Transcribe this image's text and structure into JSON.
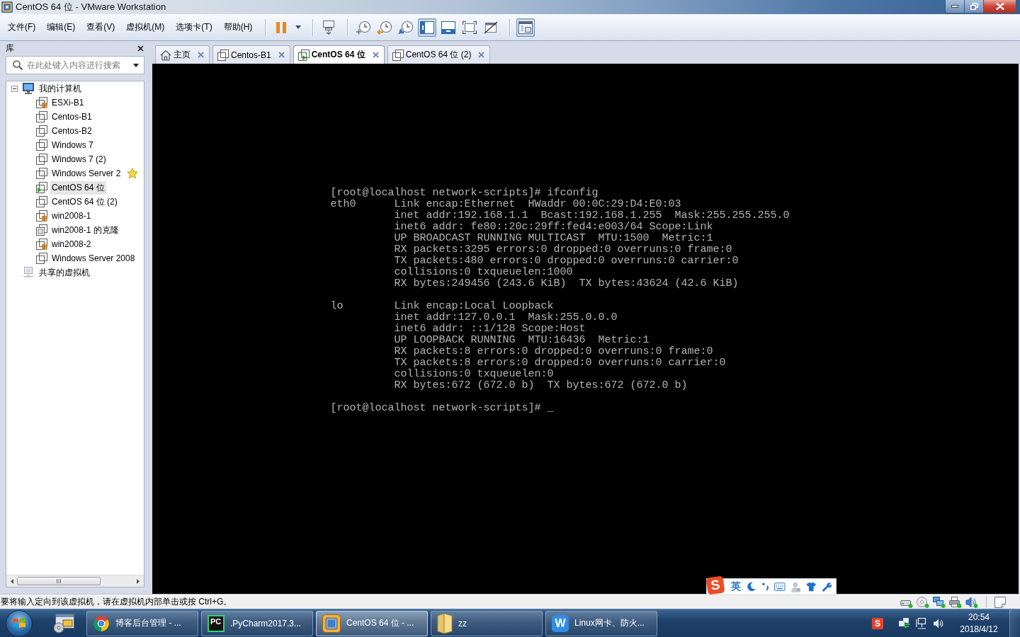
{
  "window": {
    "title": "CentOS 64 位 - VMware Workstation"
  },
  "menu": [
    "文件(F)",
    "编辑(E)",
    "查看(V)",
    "虚拟机(M)",
    "选项卡(T)",
    "帮助(H)"
  ],
  "toolbar": {
    "view_toggles": [
      {
        "selected": true
      },
      {
        "selected": false
      },
      {
        "selected": false
      },
      {
        "selected": false
      },
      {
        "selected": true
      }
    ]
  },
  "library": {
    "title": "库",
    "search": {
      "placeholder": "在此处键入内容进行搜索"
    },
    "tree": [
      {
        "label": "我的计算机",
        "kind": "computer",
        "expanded": true,
        "selected": false,
        "children": [
          {
            "label": "ESXi-B1",
            "kind": "vm",
            "running": false,
            "suspended": true,
            "favorite": false,
            "selected": false
          },
          {
            "label": "Centos-B1",
            "kind": "vm",
            "running": false,
            "suspended": false,
            "favorite": false,
            "selected": false
          },
          {
            "label": "Centos-B2",
            "kind": "vm",
            "running": false,
            "suspended": false,
            "favorite": false,
            "selected": false
          },
          {
            "label": "Windows 7",
            "kind": "vm",
            "running": false,
            "suspended": false,
            "favorite": false,
            "selected": false
          },
          {
            "label": "Windows 7 (2)",
            "kind": "vm",
            "running": false,
            "suspended": false,
            "favorite": false,
            "selected": false
          },
          {
            "label": "Windows Server 2",
            "kind": "vm",
            "running": false,
            "suspended": false,
            "favorite": true,
            "selected": false
          },
          {
            "label": "CentOS 64 位",
            "kind": "vm",
            "running": true,
            "suspended": false,
            "favorite": false,
            "selected": true
          },
          {
            "label": "CentOS 64 位 (2)",
            "kind": "vm",
            "running": false,
            "suspended": false,
            "favorite": false,
            "selected": false
          },
          {
            "label": "win2008-1",
            "kind": "vm",
            "running": false,
            "suspended": true,
            "favorite": false,
            "selected": false
          },
          {
            "label": "win2008-1 的克隆",
            "kind": "clone",
            "running": false,
            "suspended": false,
            "favorite": false,
            "selected": false
          },
          {
            "label": "win2008-2",
            "kind": "vm",
            "running": false,
            "suspended": true,
            "favorite": false,
            "selected": false
          },
          {
            "label": "Windows Server 2008",
            "kind": "vm",
            "running": false,
            "suspended": false,
            "favorite": false,
            "selected": false
          }
        ]
      },
      {
        "label": "共享的虚拟机",
        "kind": "shared",
        "selected": false
      }
    ]
  },
  "tabs": [
    {
      "label": "主页",
      "kind": "home",
      "selected": false
    },
    {
      "label": "Centos-B1",
      "kind": "vm",
      "running": false,
      "selected": false
    },
    {
      "label": "CentOS 64 位",
      "kind": "vm",
      "running": true,
      "selected": true
    },
    {
      "label": "CentOS 64 位 (2)",
      "kind": "vm",
      "running": false,
      "selected": false
    }
  ],
  "console": {
    "entries": [
      {
        "kind": "prompt",
        "text": "[root@localhost network-scripts]# ifconfig"
      },
      {
        "kind": "interface",
        "name": "eth0",
        "lines": [
          "Link encap:Ethernet  HWaddr 00:0C:29:D4:E0:03",
          "inet addr:192.168.1.1  Bcast:192.168.1.255  Mask:255.255.255.0",
          "inet6 addr: fe80::20c:29ff:fed4:e003/64 Scope:Link",
          "UP BROADCAST RUNNING MULTICAST  MTU:1500  Metric:1",
          "RX packets:3295 errors:0 dropped:0 overruns:0 frame:0",
          "TX packets:480 errors:0 dropped:0 overruns:0 carrier:0",
          "collisions:0 txqueuelen:1000",
          "RX bytes:249456 (243.6 KiB)  TX bytes:43624 (42.6 KiB)"
        ]
      },
      {
        "kind": "interface",
        "name": "lo",
        "lines": [
          "Link encap:Local Loopback",
          "inet addr:127.0.0.1  Mask:255.0.0.0",
          "inet6 addr: ::1/128 Scope:Host",
          "UP LOOPBACK RUNNING  MTU:16436  Metric:1",
          "RX packets:8 errors:0 dropped:0 overruns:0 frame:0",
          "TX packets:8 errors:0 dropped:0 overruns:0 carrier:0",
          "collisions:0 txqueuelen:0",
          "RX bytes:672 (672.0 b)  TX bytes:672 (672.0 b)"
        ]
      },
      {
        "kind": "prompt",
        "text": "[root@localhost network-scripts]# _"
      }
    ]
  },
  "ime_bar": {
    "logo": "S",
    "mode": "英"
  },
  "status_bar": {
    "message": "要将输入定向到该虚拟机，请在虚拟机内部单击或按 Ctrl+G。",
    "devices": [
      {
        "kind": "disk",
        "connected": true
      },
      {
        "kind": "cd",
        "connected": true
      },
      {
        "kind": "network",
        "connected": true
      },
      {
        "kind": "printer",
        "connected": true
      },
      {
        "kind": "sound",
        "connected": true
      }
    ]
  },
  "taskbar": {
    "buttons": [
      {
        "kind": "browser",
        "label": "博客后台管理 - ...",
        "selected": false
      },
      {
        "kind": "ide",
        "logo": "PC",
        "label": ".PyCharm2017.3...",
        "selected": false
      },
      {
        "kind": "vmware",
        "label": "CentOS 64 位 - ...",
        "selected": true
      },
      {
        "kind": "folder",
        "label": "zz",
        "selected": false
      },
      {
        "kind": "writer",
        "logo": "W",
        "label": "Linux网卡、防火...",
        "selected": false
      }
    ],
    "tray": {
      "ime_logo": "S"
    },
    "clock": {
      "time": "20:54",
      "date": "2018/4/12"
    }
  }
}
